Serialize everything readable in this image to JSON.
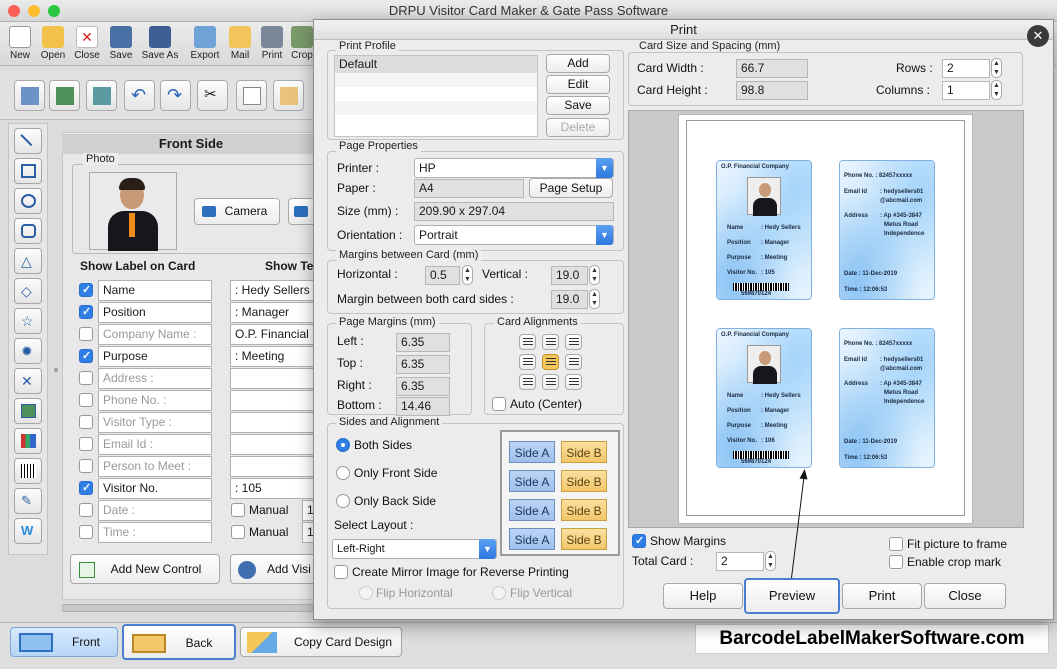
{
  "app": {
    "title": "DRPU Visitor Card Maker & Gate Pass Software"
  },
  "toolbar": {
    "items": [
      "New",
      "Open",
      "Close",
      "Save",
      "Save As",
      "Export",
      "Mail",
      "Print",
      "Crop"
    ]
  },
  "design": {
    "front_side_title": "Front Side",
    "photo_label": "Photo",
    "camera_label": "Camera",
    "show_label_header": "Show Label on Card",
    "show_text_header": "Show Te",
    "rows": [
      {
        "label": "Name",
        "checked": true,
        "value": ": Hedy Sellers"
      },
      {
        "label": "Position",
        "checked": true,
        "value": ": Manager"
      },
      {
        "label": "Company Name :",
        "checked": false,
        "value": "O.P. Financial"
      },
      {
        "label": "Purpose",
        "checked": true,
        "value": ": Meeting"
      },
      {
        "label": "Address :",
        "checked": false,
        "value": ""
      },
      {
        "label": "Phone No. :",
        "checked": false,
        "value": ""
      },
      {
        "label": "Visitor Type :",
        "checked": false,
        "value": ""
      },
      {
        "label": "Email Id :",
        "checked": false,
        "value": ""
      },
      {
        "label": "Person to Meet :",
        "checked": false,
        "value": ""
      },
      {
        "label": "Visitor No.",
        "checked": true,
        "value": ": 105"
      },
      {
        "label": "Date :",
        "checked": false,
        "value": "Manual"
      },
      {
        "label": "Time :",
        "checked": false,
        "value": "Manual"
      }
    ],
    "manual_extra": "1",
    "add_new_control": "Add New Control",
    "add_visitor": "Add Visi"
  },
  "bottom": {
    "front": "Front",
    "back": "Back",
    "copy_card_design": "Copy Card Design",
    "watermark": "BarcodeLabelMakerSoftware.com"
  },
  "print_dialog": {
    "title": "Print",
    "print_profile": {
      "label": "Print Profile",
      "items": [
        "Default"
      ],
      "add": "Add",
      "edit": "Edit",
      "save": "Save",
      "delete": "Delete"
    },
    "page_properties": {
      "label": "Page Properties",
      "printer_label": "Printer :",
      "printer": "HP",
      "paper_label": "Paper :",
      "paper": "A4",
      "page_setup": "Page Setup",
      "size_label": "Size (mm) :",
      "size": "209.90 x 297.04",
      "orientation_label": "Orientation :",
      "orientation": "Portrait"
    },
    "margins_between_card": {
      "label": "Margins between Card (mm)",
      "horizontal_label": "Horizontal :",
      "horizontal": "0.5",
      "vertical_label": "Vertical :",
      "vertical": "19.0",
      "both_label": "Margin between both card sides :",
      "both": "19.0"
    },
    "page_margins": {
      "label": "Page Margins (mm)",
      "left_label": "Left :",
      "left": "6.35",
      "top_label": "Top :",
      "top": "6.35",
      "right_label": "Right :",
      "right": "6.35",
      "bottom_label": "Bottom :",
      "bottom": "14.46"
    },
    "card_alignments": {
      "label": "Card Alignments",
      "auto_center": "Auto (Center)"
    },
    "sides": {
      "label": "Sides and Alignment",
      "both": "Both Sides",
      "front_only": "Only Front Side",
      "back_only": "Only Back Side",
      "select_layout": "Select Layout :",
      "layout": "Left-Right",
      "side_a": "Side A",
      "side_b": "Side B",
      "mirror": "Create Mirror Image for Reverse Printing",
      "flip_h": "Flip Horizontal",
      "flip_v": "Flip Vertical"
    },
    "card_size": {
      "label": "Card Size and Spacing (mm)",
      "width_label": "Card Width :",
      "width": "66.7",
      "height_label": "Card Height :",
      "height": "98.8",
      "rows_label": "Rows :",
      "rows": "2",
      "columns_label": "Columns :",
      "columns": "1"
    },
    "preview_cards": [
      {
        "company": "O.P. Financial Company",
        "name": ": Hedy Sellers",
        "position": ": Manager",
        "purpose": ": Meeting",
        "visitor_no": ": 105",
        "barcode": "569870124"
      },
      {
        "company": "O.P. Financial Company",
        "name": ": Hedy Sellers",
        "position": ": Manager",
        "purpose": ": Meeting",
        "visitor_no": ": 106",
        "barcode": "569870124"
      }
    ],
    "card_labels": {
      "name": "Name",
      "position": "Position",
      "purpose": "Purpose",
      "visitor": "Visitor No.",
      "phone": "Phone No. : 82457xxxxx",
      "email_label": "Email Id",
      "email_1": ": hedysellers01",
      "email_2": "@abcmail.com",
      "address_label": "Address",
      "address_1": ": Ap #345-3847",
      "address_2": "Metus Road",
      "address_3": "Independence",
      "date": "Date : 11-Dec-2019",
      "time": "Time : 12:06:53"
    },
    "show_margins": "Show Margins",
    "total_card_label": "Total Card :",
    "total_card": "2",
    "fit_picture": "Fit picture to frame",
    "crop_mark": "Enable crop mark",
    "help": "Help",
    "preview": "Preview",
    "print": "Print",
    "close": "Close"
  }
}
